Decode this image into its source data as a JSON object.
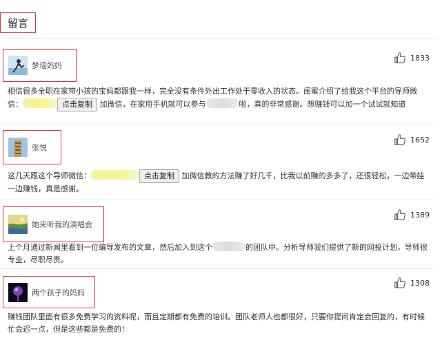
{
  "header": {
    "title": "留言"
  },
  "comments": [
    {
      "user": "梦瑶妈妈",
      "likes": "1833",
      "text_a": "相信很多全职在家带小孩的宝妈都跟我一样，完全没有条件外出工作处于零收入的状态。闺蜜介绍了给我这个平台的导师微信：",
      "copy_label": "点击复制",
      "text_b": "加微信，在家用手机就可以参与",
      "text_c": "啦，真的非常感谢。想赚钱可以加一个试试就知道"
    },
    {
      "user": "张悦",
      "likes": "1652",
      "text_a": "这几天跟这个导师微信：",
      "copy_label": "点击复制",
      "text_b": "加微信教的方法赚了好几千，比我以前赚的多多了，还很轻松，一边带娃一边赚钱，真是感谢。"
    },
    {
      "user": "她来听我的演唱会",
      "likes": "1389",
      "text_a": "上个月通过新闻里看到一位编导发布的文章，然后加入到这个",
      "text_b": "的团队中。分析导师我们提供了新的网投计划，导师很专业，尽职尽责。"
    },
    {
      "user": "两个孩子的妈妈",
      "likes": "1308",
      "text_a": "赚钱团队里面有很多免费学习的资料呢，而且定期都有免费的培训。团队老师人也都很好，只要你提问肯定会回复的，有时候忙会迟一点，但是这些都是免费的！"
    }
  ]
}
